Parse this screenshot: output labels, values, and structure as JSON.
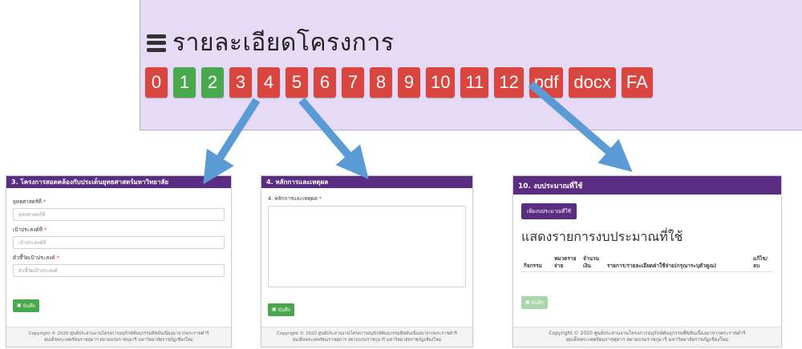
{
  "banner": {
    "title": "รายละเอียดโครงการ",
    "buttons": [
      {
        "label": "0",
        "color": "#d9463f"
      },
      {
        "label": "1",
        "color": "#49a84e"
      },
      {
        "label": "2",
        "color": "#49a84e"
      },
      {
        "label": "3",
        "color": "#d9463f"
      },
      {
        "label": "4",
        "color": "#d9463f"
      },
      {
        "label": "5",
        "color": "#d9463f"
      },
      {
        "label": "6",
        "color": "#d9463f"
      },
      {
        "label": "7",
        "color": "#d9463f"
      },
      {
        "label": "8",
        "color": "#d9463f"
      },
      {
        "label": "9",
        "color": "#d9463f"
      },
      {
        "label": "10",
        "color": "#d9463f"
      },
      {
        "label": "11",
        "color": "#d9463f"
      },
      {
        "label": "12",
        "color": "#d9463f"
      },
      {
        "label": "pdf",
        "color": "#d9463f"
      },
      {
        "label": "docx",
        "color": "#d9463f"
      },
      {
        "label": "FA",
        "color": "#d9463f"
      }
    ]
  },
  "card3": {
    "header": "3. โครงการสอดคล้องกับประเด็นยุทธศาสตร์มหาวิทยาลัย",
    "fields": [
      {
        "label": "ยุทธศาสตร์ที่",
        "placeholder": "ยุทธศาสตร์ที่"
      },
      {
        "label": "เป้าประสงค์ที่",
        "placeholder": "เป้าประสงค์ที่"
      },
      {
        "label": "ตัวชี้วัดเป้าประสงค์",
        "placeholder": "ตัวชี้วัดเป้าประสงค์"
      }
    ],
    "required_mark": "*",
    "save_label": "บันทึก",
    "footer_line1": "Copyright © 2020 ศูนย์ประสานงานโครงการอนุรักษ์พันธุกรรมพืชอันเนื่องมาจากพระราชดำริ",
    "footer_line2": "สมเด็จพระเทพรัตนราชสุดาฯ สยามบรมราชกุมารี มหาวิทยาลัยราชภัฏเชียงใหม่"
  },
  "card4": {
    "header": "4. หลักการและเหตุผล",
    "field_label": "4. หลักการและเหตุผล",
    "required_mark": "*",
    "save_label": "บันทึก",
    "footer_line1": "Copyright © 2020 ศูนย์ประสานงานโครงการอนุรักษ์พันธุกรรมพืชอันเนื่องมาจากพระราชดำริ",
    "footer_line2": "สมเด็จพระเทพรัตนราชสุดาฯ สยามบรมราชกุมารี มหาวิทยาลัยราชภัฏเชียงใหม่"
  },
  "card10": {
    "header": "10. งบประมาณที่ใช้",
    "add_label": "เพิ่มงบประมาณที่ใช้",
    "section_title": "แสดงรายการงบประมาณที่ใช้",
    "table_headers": [
      "กิจกรรม",
      "หมวดรายจ่าย",
      "จำนวนเงิน",
      "รายการ/รายละเอียดค่าใช้จ่าย(กรุณาระบุตัวคูณ)",
      "แก้ไข/ลบ"
    ],
    "save_label": "บันทึก",
    "footer_line1": "Copyright © 2020 ศูนย์ประสานงานโครงการอนุรักษ์พันธุกรรมพืชอันเนื่องมาจากพระราชดำริ",
    "footer_line2": "สมเด็จพระเทพรัตนราชสุดาฯ สยามบรมราชกุมารี มหาวิทยาลัยราชภัฏเชียงใหม่"
  },
  "colors": {
    "header_purple": "#5b2d82",
    "banner_bg": "#e6daf6",
    "arrow_blue": "#5b9bd5"
  }
}
